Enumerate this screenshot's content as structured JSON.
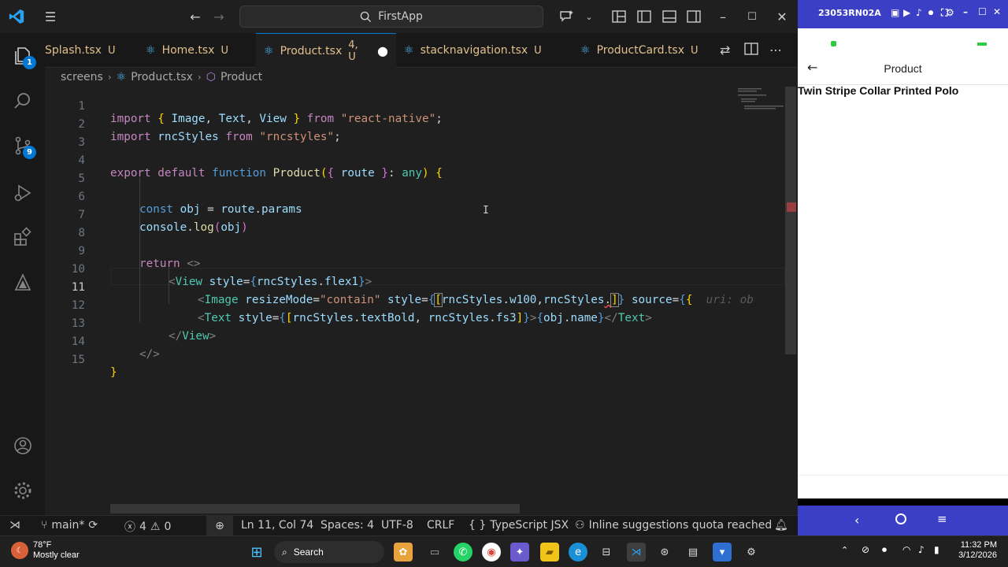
{
  "titlebar": {
    "search_text": "FirstApp",
    "icons": [
      "vscode-logo",
      "menu-icon",
      "back-arrow-icon",
      "forward-arrow-icon",
      "search-icon",
      "copilot-icon",
      "chevron-down-icon",
      "layout-icon",
      "toggle-sidebar-icon",
      "toggle-panel-icon",
      "toggle-secondary-sidebar-icon",
      "minimize-icon",
      "maximize-icon",
      "close-icon"
    ]
  },
  "activity_bar": {
    "items": [
      {
        "name": "explorer",
        "badge": "1"
      },
      {
        "name": "search",
        "badge": ""
      },
      {
        "name": "source-control",
        "badge": "9"
      },
      {
        "name": "run-debug",
        "badge": ""
      },
      {
        "name": "extensions",
        "badge": ""
      },
      {
        "name": "testing",
        "badge": ""
      }
    ],
    "bottom": [
      "accounts",
      "settings"
    ]
  },
  "tabs": [
    {
      "label": "Splash.tsx",
      "status": "U"
    },
    {
      "label": "Home.tsx",
      "status": "U"
    },
    {
      "label": "Product.tsx",
      "status": "4, U",
      "active": true,
      "dirty": true
    },
    {
      "label": "stacknavigation.tsx",
      "status": "U"
    },
    {
      "label": "ProductCard.tsx",
      "status": "U"
    }
  ],
  "breadcrumb": {
    "folder": "screens",
    "file": "Product.tsx",
    "symbol": "Product"
  },
  "editor": {
    "current_line": 11,
    "line_numbers": [
      "1",
      "2",
      "3",
      "4",
      "5",
      "6",
      "7",
      "8",
      "9",
      "10",
      "11",
      "12",
      "13",
      "14",
      "15"
    ],
    "lines": {
      "l1": [
        "import",
        " { ",
        "Image",
        ", ",
        "Text",
        ", ",
        "View",
        " } ",
        "from",
        " ",
        "\"react-native\"",
        ";"
      ],
      "l2": [
        "import",
        " ",
        "rncStyles",
        " ",
        "from",
        " ",
        "\"rncstyles\"",
        ";"
      ],
      "l4": [
        "export",
        " ",
        "default",
        " ",
        "function",
        " ",
        "Product",
        "(",
        "{",
        " ",
        "route",
        " ",
        "}",
        ": ",
        "any",
        ")",
        " ",
        "{"
      ],
      "l6": [
        "const",
        " ",
        "obj",
        " = ",
        "route",
        ".",
        "params"
      ],
      "l7": [
        "console",
        ".",
        "log",
        "(",
        "obj",
        ")"
      ],
      "l9": [
        "return",
        " ",
        "<>"
      ],
      "l10": [
        "<",
        "View",
        " ",
        "style",
        "=",
        "{",
        "rncStyles",
        ".",
        "flex1",
        "}",
        ">"
      ],
      "l11": [
        "<",
        "Image",
        " ",
        "resizeMode",
        "=",
        "\"contain\"",
        " ",
        "style",
        "=",
        "{",
        "[",
        "rncStyles",
        ".",
        "w100",
        ",",
        "rncStyles",
        ".",
        "]",
        "}",
        " ",
        "source",
        "=",
        "{",
        "{",
        "  uri: ob"
      ],
      "l12": [
        "<",
        "Text",
        " ",
        "style",
        "=",
        "{",
        "[",
        "rncStyles",
        ".",
        "textBold",
        ", ",
        "rncStyles",
        ".",
        "fs3",
        "]",
        "}",
        ">",
        "{",
        "obj",
        ".",
        "name",
        "}",
        "</",
        "Text",
        ">"
      ],
      "l13": [
        "</",
        "View",
        ">"
      ],
      "l14": [
        "</>"
      ],
      "l15": [
        "}"
      ]
    }
  },
  "statusbar": {
    "branch": "main*",
    "errors": "4",
    "warnings": "0",
    "position": "Ln 11, Col 74",
    "spaces": "Spaces: 4",
    "encoding": "UTF-8",
    "eol": "CRLF",
    "language": "TypeScript JSX",
    "copilot": "Inline suggestions quota reached"
  },
  "phone": {
    "device": "23053RN02A",
    "header_title": "Product",
    "product_name": "Twin Stripe Collar Printed Polo"
  },
  "taskbar": {
    "weather_temp": "78°F",
    "weather_desc": "Mostly clear",
    "search_label": "Search",
    "time": "11:32 PM",
    "date": "3/12/2026"
  }
}
